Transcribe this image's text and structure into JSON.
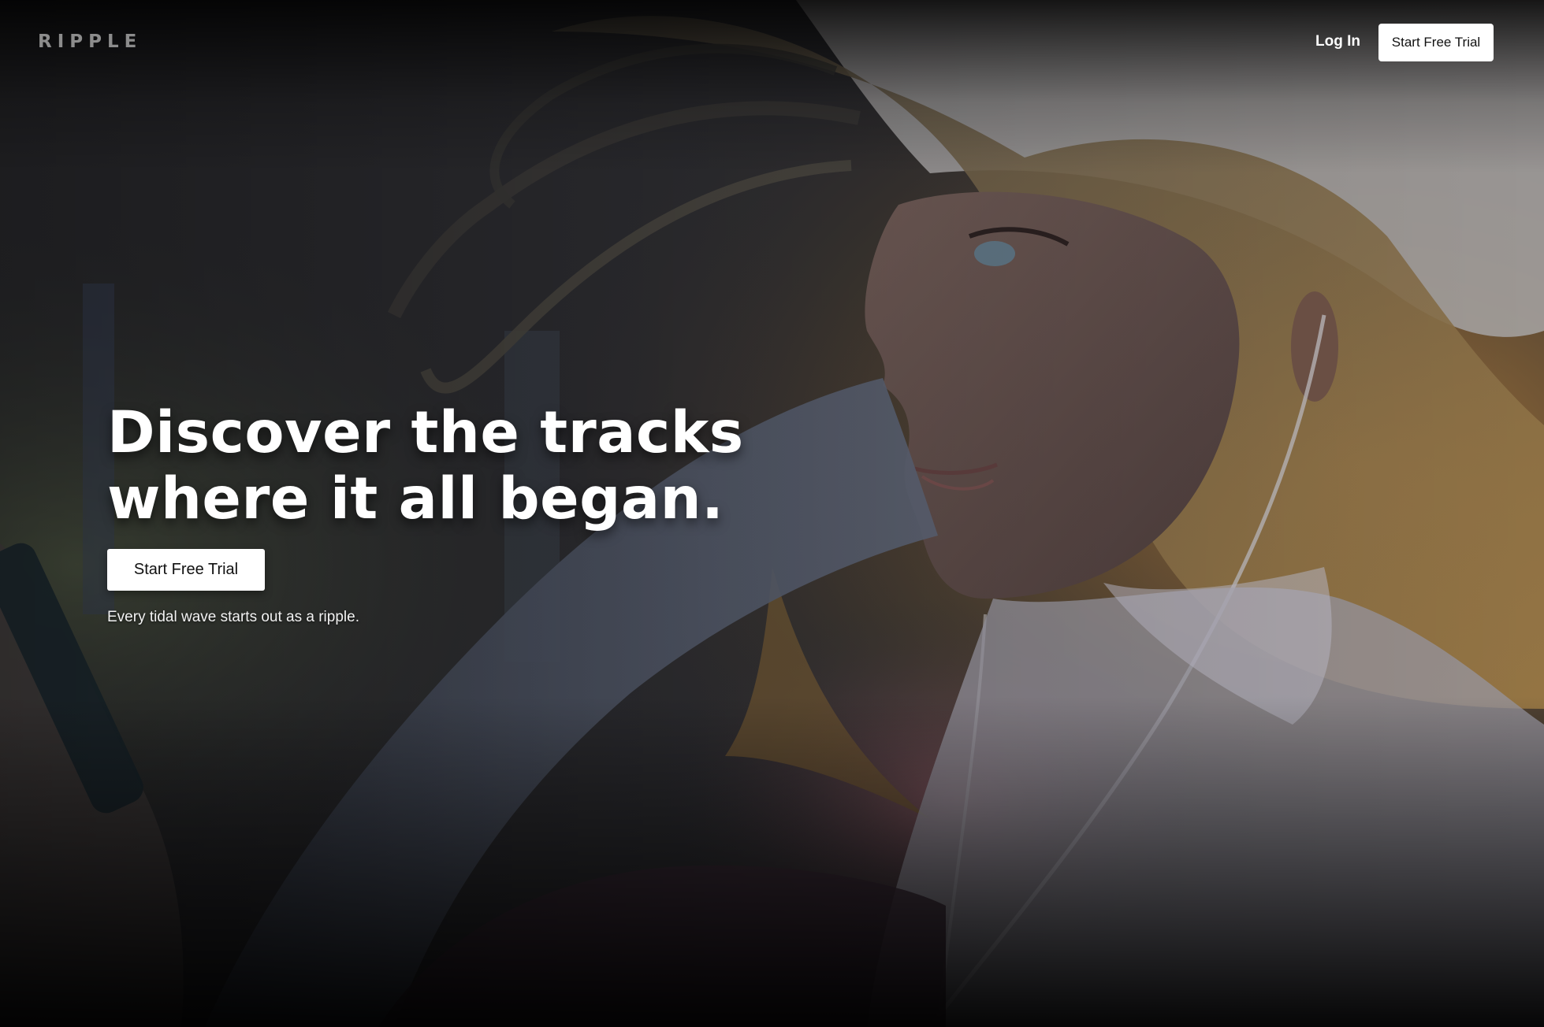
{
  "brand": {
    "logo_text": "RIPPLE"
  },
  "nav": {
    "login_label": "Log In",
    "trial_label": "Start Free Trial"
  },
  "hero": {
    "headline_line1": "Discover the tracks",
    "headline_line2": "where it all began.",
    "cta_label": "Start Free Trial",
    "tagline": "Every tidal wave starts out as a ripple.",
    "background_image": "illustration of a woman with blonde hair wearing a white hat and earphones"
  },
  "colors": {
    "button_bg": "#ffffff",
    "headline_text": "#ffffff",
    "logo_text": "#8c8c8c"
  }
}
